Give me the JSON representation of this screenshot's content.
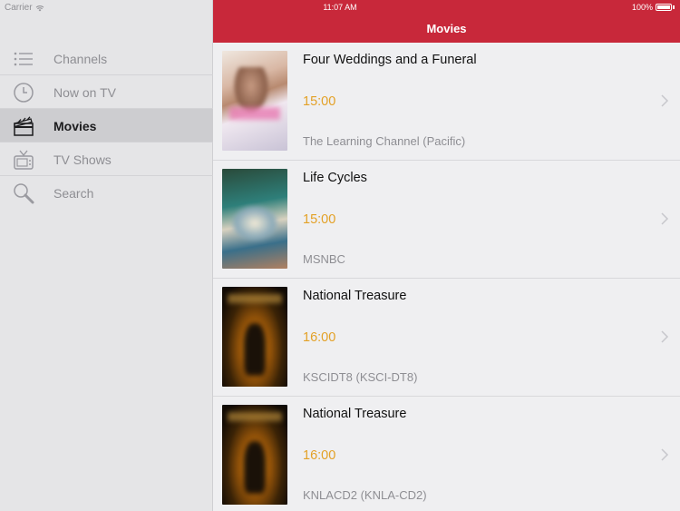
{
  "status": {
    "carrier": "Carrier",
    "time": "11:07 AM",
    "battery": "100%"
  },
  "sidebar": {
    "items": [
      {
        "label": "Channels",
        "icon": "list-icon",
        "active": false
      },
      {
        "label": "Now on TV",
        "icon": "clock-icon",
        "active": false
      },
      {
        "label": "Movies",
        "icon": "clapperboard-icon",
        "active": true
      },
      {
        "label": "TV Shows",
        "icon": "tv-icon",
        "active": false
      },
      {
        "label": "Search",
        "icon": "search-icon",
        "active": false
      }
    ]
  },
  "navbar": {
    "title": "Movies",
    "color": "#c8283a"
  },
  "movies": [
    {
      "title": "Four Weddings and a Funeral",
      "time": "15:00",
      "channel": "The Learning Channel (Pacific)"
    },
    {
      "title": "Life Cycles",
      "time": "15:00",
      "channel": "MSNBC"
    },
    {
      "title": "National Treasure",
      "time": "16:00",
      "channel": "KSCIDT8 (KSCI-DT8)"
    },
    {
      "title": "National Treasure",
      "time": "16:00",
      "channel": "KNLACD2 (KNLA-CD2)"
    }
  ],
  "colors": {
    "accent_time": "#e3a127",
    "sidebar_bg": "#e5e5e7"
  }
}
